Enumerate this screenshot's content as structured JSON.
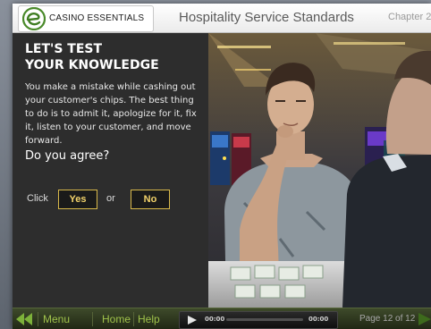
{
  "header": {
    "brand_name": "CASINO ESSENTIALS",
    "course_title": "Hospitality Service Standards",
    "chapter_label": "Chapter 2"
  },
  "quiz": {
    "heading_line1": "LET'S TEST",
    "heading_line2": "YOUR KNOWLEDGE",
    "statement": "You make a mistake while cashing out your customer's chips. The best thing to do is to admit it, apologize for it, fix it, listen to your customer, and move forward.",
    "question": "Do you agree?",
    "click_label": "Click",
    "yes_label": "Yes",
    "or_label": "or",
    "no_label": "No"
  },
  "footer": {
    "menu_label": "Menu",
    "home_label": "Home",
    "help_label": "Help",
    "time_current": "00:00",
    "time_total": "00:00",
    "progress_fraction": 0,
    "page_counter": "Page 12 of 12"
  },
  "colors": {
    "accent_green": "#9fc24b",
    "button_gold": "#f3d36b",
    "panel_dark": "#2d2d2d"
  },
  "icons": {
    "back": "double-left-arrow-icon",
    "next": "right-arrow-icon",
    "play": "play-icon",
    "logo": "e-swoosh-logo"
  }
}
